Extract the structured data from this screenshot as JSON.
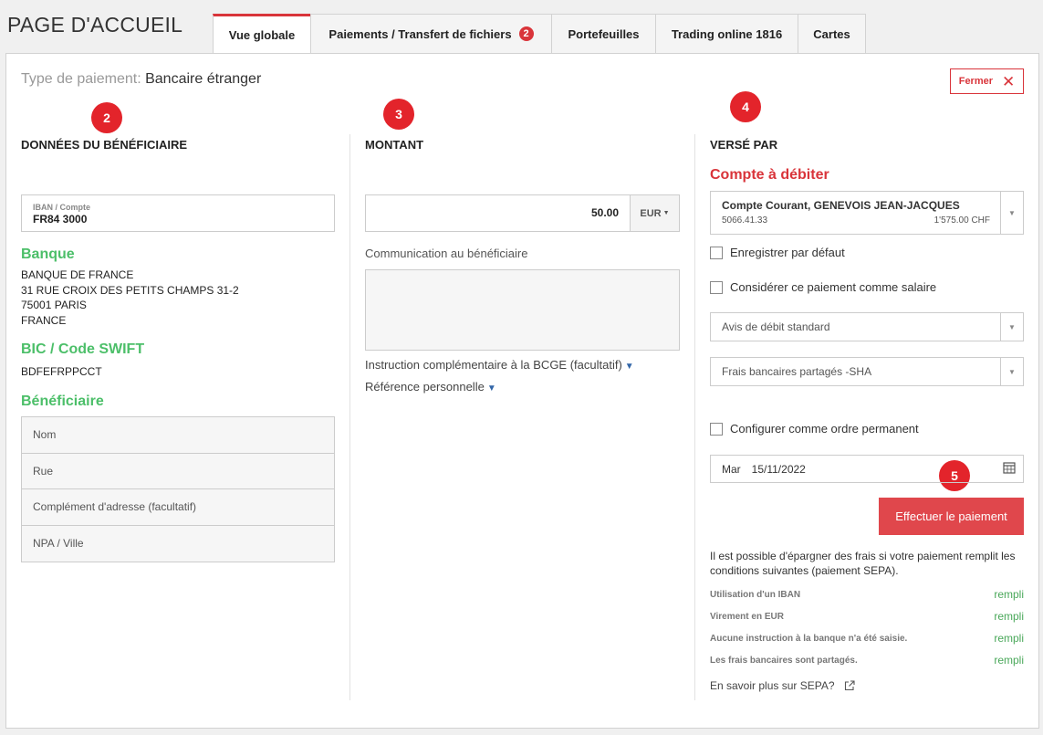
{
  "header": {
    "title": "PAGE D'ACCUEIL"
  },
  "tabs": [
    {
      "label": "Vue globale",
      "active": true
    },
    {
      "label": "Paiements / Transfert de fichiers",
      "badge": "2"
    },
    {
      "label": "Portefeuilles"
    },
    {
      "label": "Trading online 1816"
    },
    {
      "label": "Cartes"
    }
  ],
  "panel": {
    "type_label": "Type de paiement:",
    "type_value": "Bancaire étranger",
    "close_label": "Fermer"
  },
  "markers": [
    "2",
    "3",
    "4",
    "5"
  ],
  "beneficiary": {
    "heading": "DONNÉES DU BÉNÉFICIAIRE",
    "iban_label": "IBAN / Compte",
    "iban_value": "FR84 3000",
    "bank_heading": "Banque",
    "bank_lines": [
      "BANQUE DE FRANCE",
      "31 RUE CROIX DES PETITS CHAMPS 31-2",
      "75001 PARIS",
      "FRANCE"
    ],
    "bic_heading": "BIC / Code SWIFT",
    "bic_value": "BDFEFRPPCCT",
    "benef_heading": "Bénéficiaire",
    "fields": [
      "Nom",
      "Rue",
      "Complément d'adresse (facultatif)",
      "NPA / Ville"
    ]
  },
  "amount": {
    "heading": "MONTANT",
    "value": "50.00",
    "currency": "EUR",
    "communication_label": "Communication au bénéficiaire",
    "instruction_link": "Instruction complémentaire à la BCGE (facultatif)",
    "reference_link": "Référence personnelle"
  },
  "payer": {
    "heading": "VERSÉ PAR",
    "debit_heading": "Compte à débiter",
    "account_name": "Compte Courant, GENEVOIS JEAN-JACQUES",
    "account_number": "5066.41.33",
    "account_balance": "1'575.00 CHF",
    "save_default": "Enregistrer par défaut",
    "salary": "Considérer ce paiement comme salaire",
    "debit_notice": "Avis de débit standard",
    "fees": "Frais bancaires partagés -SHA",
    "standing_order": "Configurer comme ordre permanent",
    "date_day": "Mar",
    "date_value": "15/11/2022",
    "pay_button": "Effectuer le paiement",
    "info_text": "Il est possible d'épargner des frais si votre paiement remplit les conditions suivantes (paiement SEPA).",
    "conditions": [
      {
        "label": "Utilisation d'un IBAN",
        "status": "rempli"
      },
      {
        "label": "Virement en EUR",
        "status": "rempli"
      },
      {
        "label": "Aucune instruction à la banque n'a été saisie.",
        "status": "rempli"
      },
      {
        "label": "Les frais bancaires sont partagés.",
        "status": "rempli"
      }
    ],
    "sepa_link": "En savoir plus sur SEPA?"
  },
  "colors": {
    "accent": "#d9343a",
    "green": "#4cbf69",
    "marker": "#e3242b"
  }
}
